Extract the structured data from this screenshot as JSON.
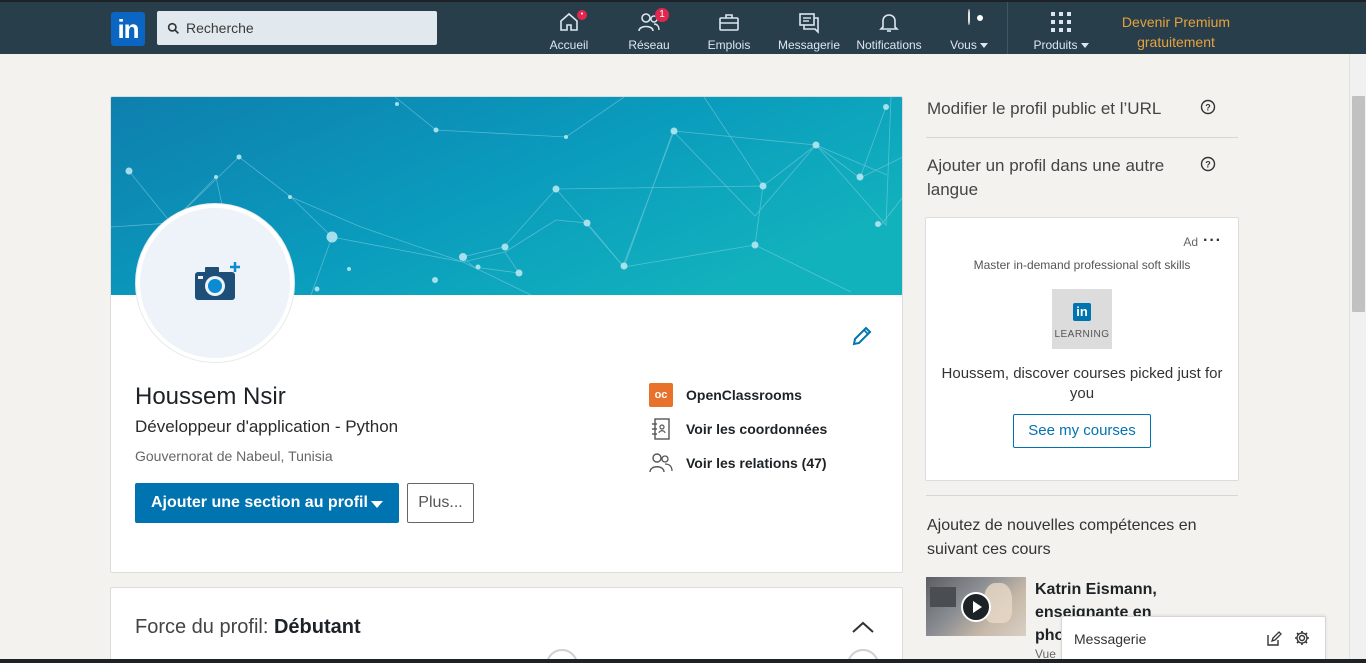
{
  "nav": {
    "logo": "in",
    "search_placeholder": "Recherche",
    "items": [
      {
        "label": "Accueil",
        "badge": ""
      },
      {
        "label": "Réseau",
        "badge": "1"
      },
      {
        "label": "Emplois"
      },
      {
        "label": "Messagerie"
      },
      {
        "label": "Notifications"
      },
      {
        "label": "Vous"
      },
      {
        "label": "Produits"
      }
    ],
    "premium_line1": "Devenir Premium",
    "premium_line2": "gratuitement",
    "colors": {
      "bar": "#283e4a",
      "premium": "#e7a33e",
      "badge": "#e0284e"
    }
  },
  "profile": {
    "name": "Houssem Nsir",
    "headline": "Développeur d'application - Python",
    "location": "Gouvernorat de Nabeul, Tunisia",
    "add_section_label": "Ajouter une section au profil",
    "more_label": "Plus...",
    "school": "OpenClassrooms",
    "school_logo": "oc",
    "contact_label": "Voir les coordonnées",
    "connections_label": "Voir les relations (47)"
  },
  "strength": {
    "label": "Force du profil:",
    "level": "Débutant"
  },
  "right_rail": {
    "public_profile_link": "Modifier le profil public et l’URL",
    "other_language_link_line1": "Ajouter un profil dans une autre",
    "other_language_link_line2": "langue",
    "ad": {
      "label": "Ad",
      "menu": "···",
      "tagline": "Master in-demand professional soft skills",
      "logo_mark": "in",
      "logo_text": "LEARNING",
      "message_line1": "Houssem, discover courses picked just for",
      "message_line2": "you",
      "cta": "See my courses"
    },
    "courses_title_line1": "Ajoutez de nouvelles compétences en",
    "courses_title_line2": "suivant ces cours",
    "course_author_line1": "Katrin Eismann,",
    "course_author_line2": "enseignante en",
    "course_author_line3": "pho",
    "course_author_line4": "Vue"
  },
  "messaging": {
    "label": "Messagerie"
  },
  "accent_color": "#0073b1"
}
